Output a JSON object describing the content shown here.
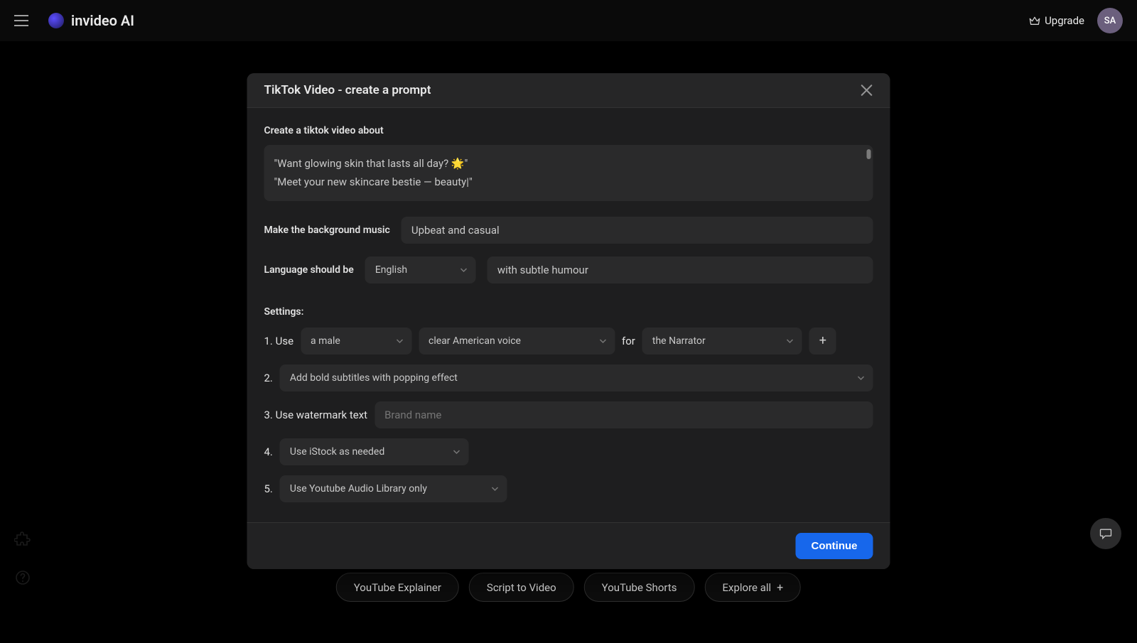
{
  "header": {
    "brand": "invideo AI",
    "upgrade": "Upgrade",
    "avatar": "SA"
  },
  "chips": [
    {
      "label": "YouTube Explainer"
    },
    {
      "label": "Script to Video"
    },
    {
      "label": "YouTube Shorts"
    },
    {
      "label": "Explore all"
    }
  ],
  "modal": {
    "title": "TikTok Video - create a prompt",
    "prompt_label": "Create a tiktok video about",
    "prompt_value": "\"Want glowing skin that lasts all day? 🌟\"\n\"Meet your new skincare bestie — beauty|\"",
    "bg_music_label": "Make the background music",
    "bg_music_value": "Upbeat and casual",
    "language_label": "Language should be",
    "language_select": "English",
    "language_tone_value": "with subtle humour",
    "settings_label": "Settings:",
    "s1": {
      "num": "1. Use",
      "gender": "a male",
      "voice": "clear American voice",
      "for": "for",
      "role": "the Narrator"
    },
    "s2": {
      "num": "2.",
      "subtitle": "Add bold subtitles with popping effect"
    },
    "s3": {
      "num": "3. Use watermark text",
      "placeholder": "Brand name"
    },
    "s4": {
      "num": "4.",
      "stock": "Use iStock as needed"
    },
    "s5": {
      "num": "5.",
      "audio": "Use Youtube Audio Library only"
    },
    "continue": "Continue"
  }
}
